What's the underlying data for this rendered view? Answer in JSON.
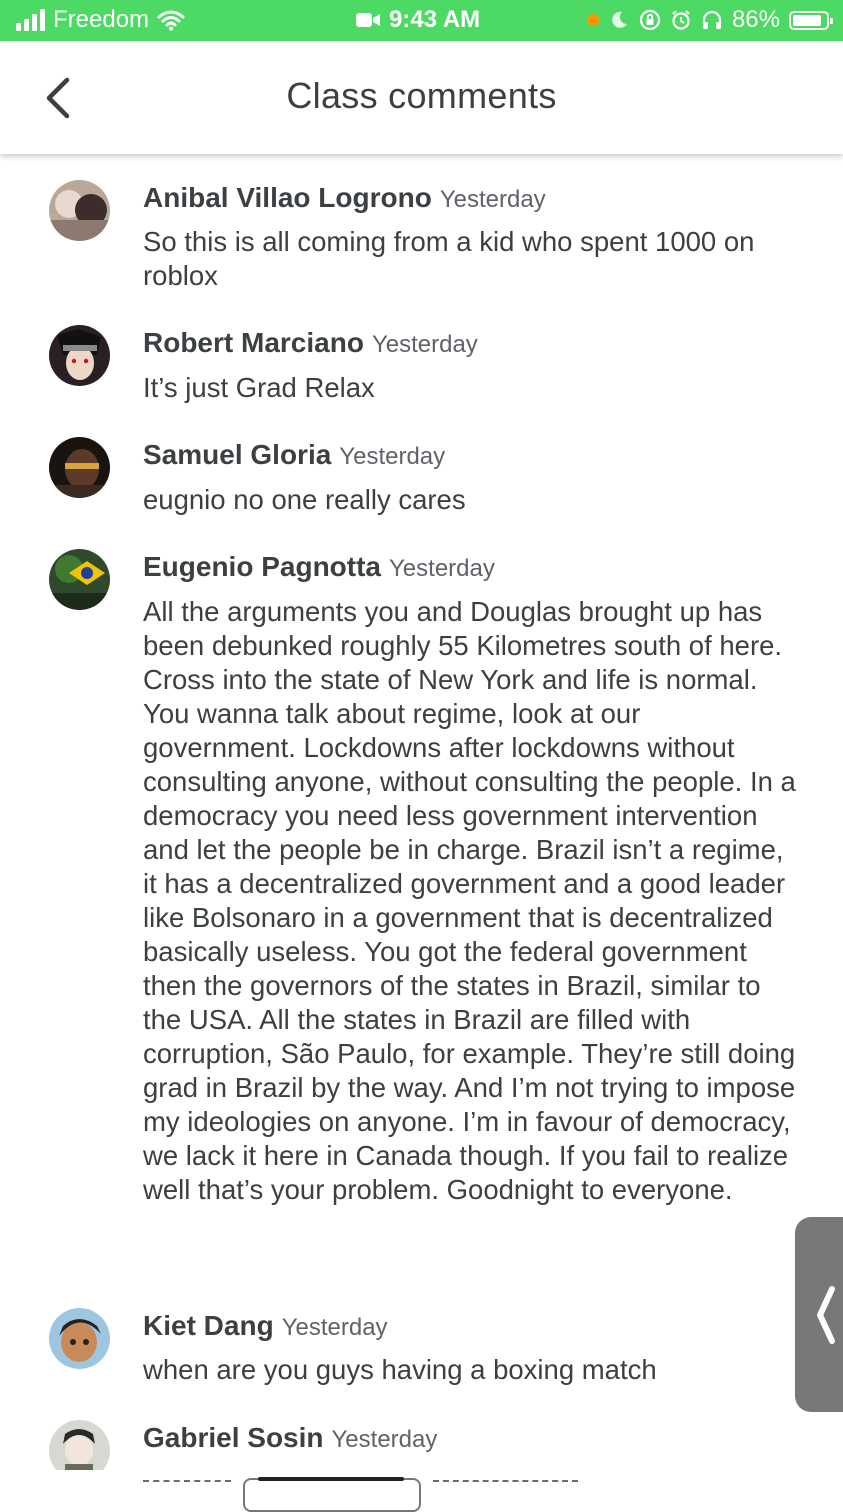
{
  "status_bar": {
    "carrier": "Freedom",
    "time": "9:43 AM",
    "battery": "86%",
    "battery_level": 0.86
  },
  "header": {
    "title": "Class comments",
    "back_icon": "chevron-left-icon"
  },
  "comments": [
    {
      "author": "Anibal Villao Logrono",
      "time": "Yesterday",
      "text": "So this is all coming from a kid who spent 1000 on roblox"
    },
    {
      "author": "Robert Marciano",
      "time": "Yesterday",
      "text": "It’s just Grad Relax"
    },
    {
      "author": "Samuel Gloria",
      "time": "Yesterday",
      "text": "eugnio no one really cares"
    },
    {
      "author": "Eugenio Pagnotta",
      "time": "Yesterday",
      "text": "All the arguments you and Douglas brought up has been debunked roughly 55 Kilometres south of here. Cross into the state of New York and life is normal. You wanna talk about regime, look at our government. Lockdowns after lockdowns without consulting anyone, without consulting the people. In a democracy you need less government intervention and let the people be in charge. Brazil isn’t a regime, it has a decentralized government and a good leader like Bolsonaro in a government that is decentralized basically useless. You got the federal government then the governors of the states in Brazil, similar to the USA. All the states in Brazil are filled with corruption, São Paulo, for example. They’re still doing grad in Brazil by the way. And I’m not trying to impose my ideologies on anyone. I’m in favour of democracy, we lack it here in Canada though. If you fail to realize well that’s your problem. Goodnight to everyone."
    },
    {
      "author": "Kiet Dang",
      "time": "Yesterday",
      "text": "when are you guys having a boxing match"
    },
    {
      "author": "Gabriel Sosin",
      "time": "Yesterday",
      "text": ""
    }
  ]
}
